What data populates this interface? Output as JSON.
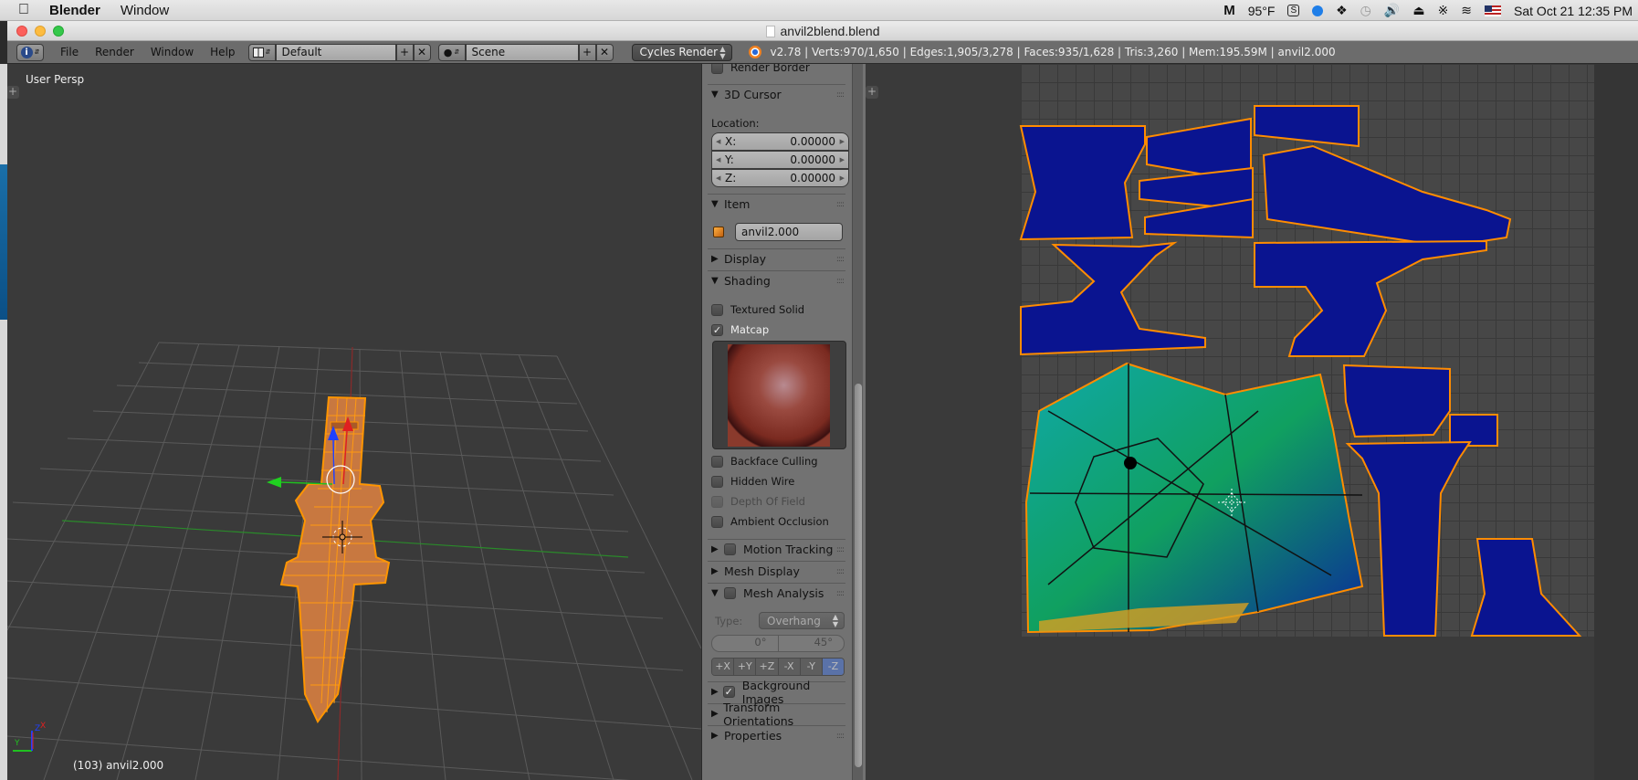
{
  "macos_menubar": {
    "app_name": "Blender",
    "menus": [
      "Window"
    ],
    "temperature": "95°F",
    "datetime": "Sat Oct 21  12:35 PM",
    "status_icons": [
      "malwarebytes-icon",
      "sophos-icon",
      "shazam-icon",
      "dropbox-icon",
      "time-machine-icon",
      "volume-icon",
      "eject-icon",
      "bluetooth-icon",
      "wifi-icon",
      "us-flag-icon"
    ]
  },
  "window": {
    "title": "anvil2blend.blend",
    "traffic_lights": {
      "close": "#fc605c",
      "minimize": "#fdbc40",
      "zoom": "#34c84a"
    }
  },
  "header": {
    "menus": [
      "File",
      "Render",
      "Window",
      "Help"
    ],
    "screen_layout": "Default",
    "scene": "Scene",
    "render_engine": "Cycles Render",
    "status": "v2.78 | Verts:970/1,650 | Edges:1,905/3,278 | Faces:935/1,628 | Tris:3,260 | Mem:195.59M | anvil2.000"
  },
  "viewport": {
    "view_label": "User Persp",
    "object_label": "(103) anvil2.000",
    "axis_labels": {
      "x": "X",
      "y": "Y",
      "z": "Z"
    },
    "colors": {
      "selection": "#ff8c00",
      "x_axis": "#e02020",
      "y_axis": "#20c020",
      "z_axis": "#2040ff",
      "background": "#3a3a3a"
    }
  },
  "properties_panel": {
    "render_border_label": "Render Border",
    "cursor_section": {
      "title": "3D Cursor",
      "location_label": "Location:",
      "x_label": "X:",
      "x_value": "0.00000",
      "y_label": "Y:",
      "y_value": "0.00000",
      "z_label": "Z:",
      "z_value": "0.00000"
    },
    "item_section": {
      "title": "Item",
      "name_value": "anvil2.000"
    },
    "display_section": {
      "title": "Display"
    },
    "shading_section": {
      "title": "Shading",
      "textured_solid": {
        "label": "Textured Solid",
        "checked": false
      },
      "matcap": {
        "label": "Matcap",
        "checked": true
      },
      "backface_culling": {
        "label": "Backface Culling",
        "checked": false
      },
      "hidden_wire": {
        "label": "Hidden Wire",
        "checked": false
      },
      "depth_of_field": {
        "label": "Depth Of Field",
        "checked": false,
        "disabled": true
      },
      "ambient_occlusion": {
        "label": "Ambient Occlusion",
        "checked": false
      }
    },
    "motion_tracking": {
      "title": "Motion Tracking",
      "checked": false
    },
    "mesh_display": {
      "title": "Mesh Display"
    },
    "mesh_analysis": {
      "title": "Mesh Analysis",
      "checked": false,
      "type_label": "Type:",
      "type_value": "Overhang",
      "min_value": "0°",
      "max_value": "45°",
      "axes": [
        "+X",
        "+Y",
        "+Z",
        "-X",
        "-Y",
        "-Z"
      ],
      "active_axis": "-Z"
    },
    "background_images": {
      "title": "Background Images",
      "checked": true
    },
    "transform_orientations": {
      "title": "Transform Orientations"
    },
    "properties": {
      "title": "Properties"
    }
  },
  "uv_editor": {
    "colors": {
      "island_fill": "#0a1a8c",
      "edge": "#ff8c00",
      "stretch_high": "#10b060",
      "stretch_mid": "#10a0a0",
      "grid": "#474747"
    }
  }
}
